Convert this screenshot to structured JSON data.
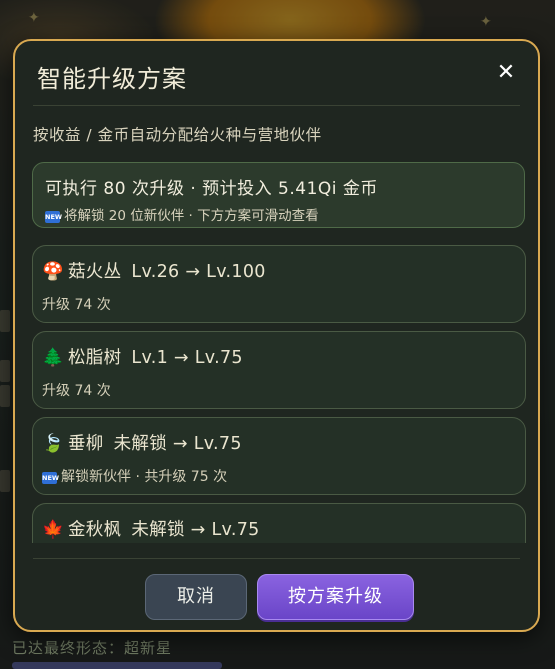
{
  "background": {
    "footer_text": "已达最终形态：超新星"
  },
  "dialog": {
    "title": "智能升级方案",
    "close_icon": "close-icon",
    "subtitle": "按收益 / 金币自动分配给火种与营地伙伴",
    "summary": {
      "line1": "可执行 80 次升级 · 预计投入 5.41Qi 金币",
      "new_badge": "NEW",
      "line2": "将解锁 20 位新伙伴 · 下方方案可滑动查看"
    },
    "plans": [
      {
        "icon": "mushroom-icon",
        "glyph": "🍄",
        "name": "菇火丛",
        "level": "Lv.26 → Lv.100",
        "detail": "升级 74 次",
        "is_new": false
      },
      {
        "icon": "pine-tree-icon",
        "glyph": "🌲",
        "name": "松脂树",
        "level": "Lv.1 → Lv.75",
        "detail": "升级 74 次",
        "is_new": false
      },
      {
        "icon": "leaf-icon",
        "glyph": "🍃",
        "name": "垂柳",
        "level": "未解锁 → Lv.75",
        "detail": "解锁新伙伴 · 共升级 75 次",
        "is_new": true
      },
      {
        "icon": "maple-leaf-icon",
        "glyph": "🍁",
        "name": "金秋枫",
        "level": "未解锁 → Lv.75",
        "detail": "",
        "is_new": false
      }
    ],
    "cancel_label": "取消",
    "confirm_label": "按方案升级"
  },
  "colors": {
    "dialog_border": "#d9a951",
    "dialog_bg": "#1f2620",
    "confirm_button": "#7b55d6",
    "cancel_button": "#3a4552",
    "new_badge": "#2f6fd6"
  }
}
